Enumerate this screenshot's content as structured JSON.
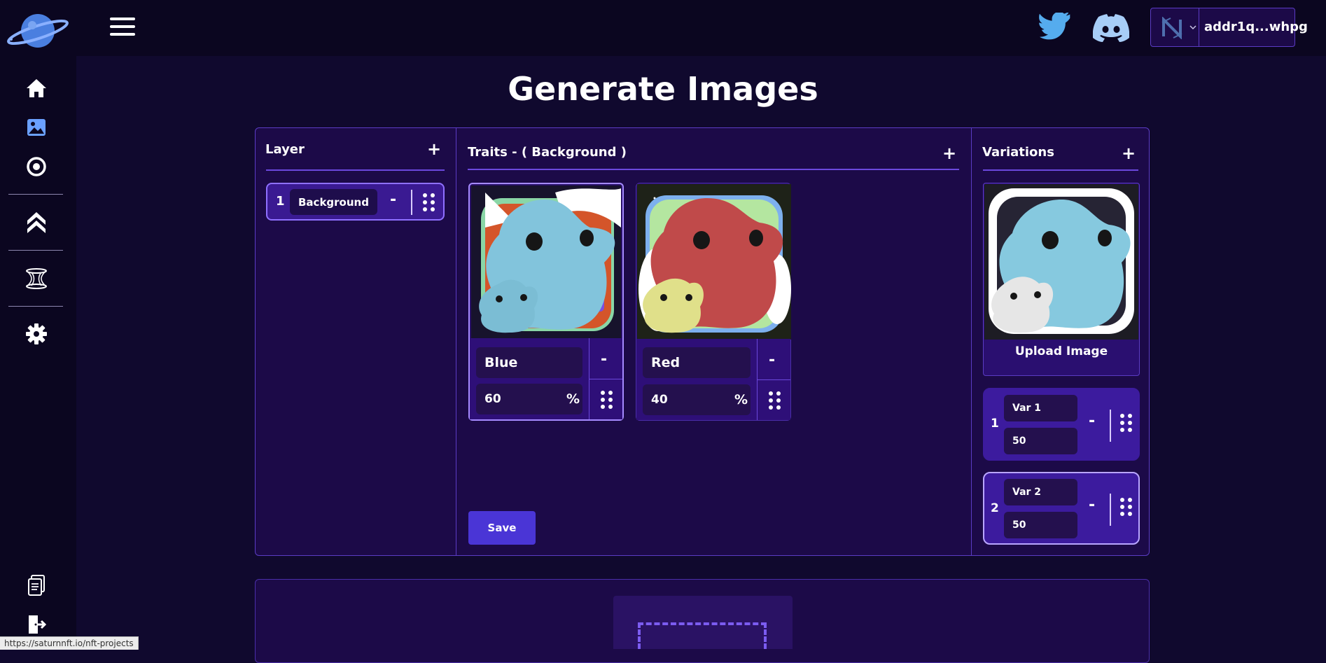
{
  "header": {
    "menu_icon": "hamburger-menu-icon",
    "twitter_icon": "twitter-icon",
    "discord_icon": "discord-icon",
    "wallet": {
      "icon": "nami-wallet-icon",
      "address": "addr1q...whpg"
    }
  },
  "sidebar": {
    "logo_icon": "planet-logo-icon",
    "items": [
      {
        "icon": "home-icon"
      },
      {
        "icon": "image-icon"
      },
      {
        "icon": "target-circle-icon"
      },
      {
        "icon": "double-chevron-up-icon"
      },
      {
        "icon": "hourglass-structure-icon"
      },
      {
        "icon": "gear-icon"
      },
      {
        "icon": "documents-icon"
      },
      {
        "icon": "logout-icon"
      }
    ]
  },
  "page": {
    "title": "Generate Images"
  },
  "layers": {
    "title": "Layer",
    "add_label": "+",
    "items": [
      {
        "index": "1",
        "name": "Background",
        "remove_label": "-"
      }
    ]
  },
  "traits": {
    "title": "Traits - ( Background )",
    "add_label": "+",
    "items": [
      {
        "name": "Blue",
        "percent": "60",
        "percent_symbol": "%",
        "remove_label": "-"
      },
      {
        "name": "Red",
        "percent": "40",
        "percent_symbol": "%",
        "remove_label": "-"
      }
    ],
    "save_label": "Save"
  },
  "variations": {
    "title": "Variations",
    "add_label": "+",
    "upload_label": "Upload Image",
    "items": [
      {
        "index": "1",
        "name": "Var 1",
        "value": "50",
        "remove_label": "-"
      },
      {
        "index": "2",
        "name": "Var 2",
        "value": "50",
        "remove_label": "-"
      }
    ]
  },
  "status_bar": {
    "url": "https://saturnnft.io/nft-projects"
  },
  "colors": {
    "background": "#10092e",
    "panel": "#1c0a48",
    "accent": "#6b48dc",
    "save_button": "#4a35d6"
  }
}
